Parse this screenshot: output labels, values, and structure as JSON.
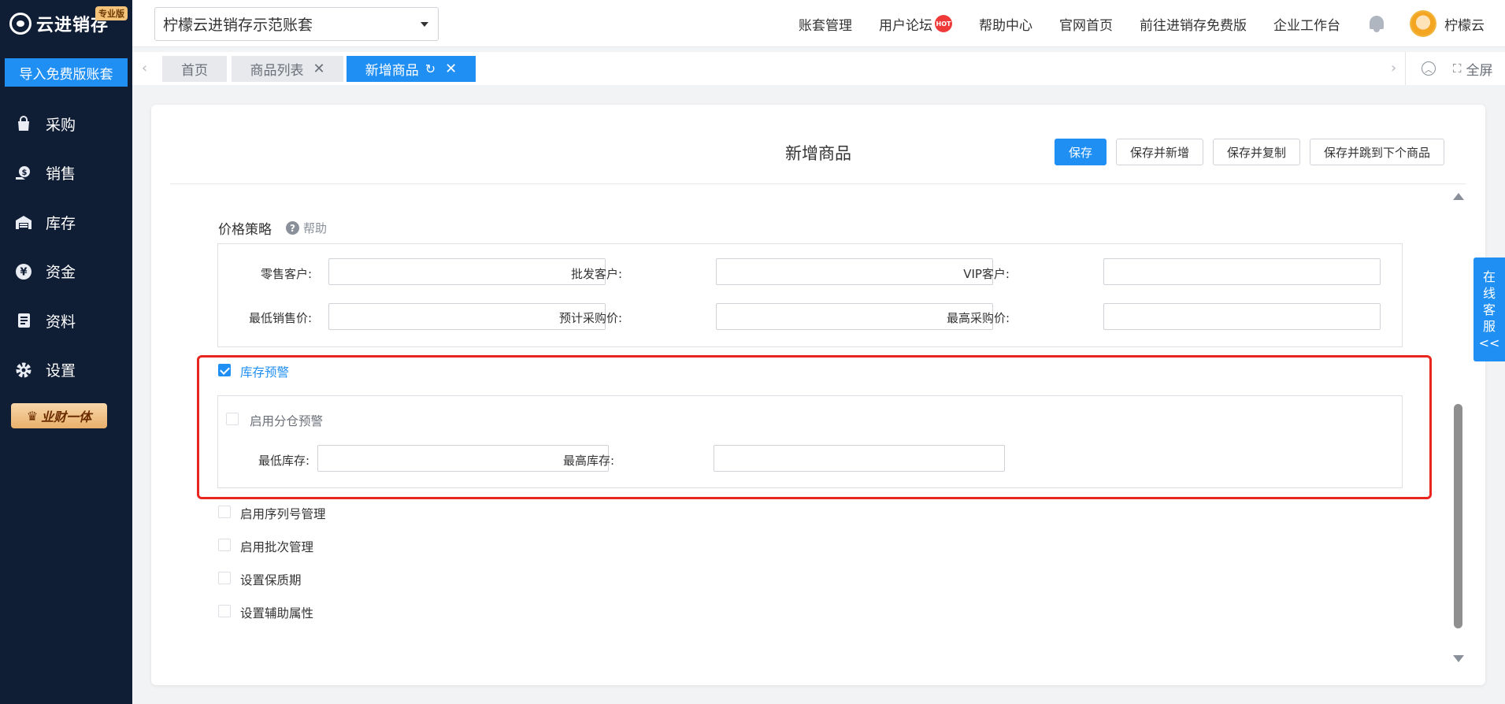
{
  "sidebar": {
    "logo_text": "云进销存",
    "logo_badge": "专业版",
    "import_button": "导入免费版账套",
    "items": [
      {
        "label": "采购",
        "icon": "bag-icon"
      },
      {
        "label": "销售",
        "icon": "coin-hand-icon"
      },
      {
        "label": "库存",
        "icon": "warehouse-icon"
      },
      {
        "label": "资金",
        "icon": "yen-icon"
      },
      {
        "label": "资料",
        "icon": "document-icon"
      },
      {
        "label": "设置",
        "icon": "gear-icon"
      }
    ],
    "promo": "业财一体"
  },
  "topbar": {
    "account_name": "柠檬云进销存示范账套",
    "links": [
      "账套管理",
      "用户论坛",
      "帮助中心",
      "官网首页",
      "前往进销存免费版",
      "企业工作台"
    ],
    "hot_badge": "HOT",
    "user_name": "柠檬云"
  },
  "tabs": {
    "items": [
      {
        "label": "首页"
      },
      {
        "label": "商品列表"
      },
      {
        "label": "新增商品"
      }
    ],
    "fullscreen": "全屏"
  },
  "page": {
    "title": "新增商品",
    "buttons": {
      "save": "保存",
      "save_new": "保存并新增",
      "save_copy": "保存并复制",
      "save_next": "保存并跳到下个商品"
    },
    "price_section": {
      "title": "价格策略",
      "help": "帮助",
      "fields": {
        "retail": {
          "label": "零售客户:",
          "value": ""
        },
        "wholesale": {
          "label": "批发客户:",
          "value": ""
        },
        "vip": {
          "label": "VIP客户:",
          "value": ""
        },
        "min_sale": {
          "label": "最低销售价:",
          "value": ""
        },
        "est_purchase": {
          "label": "预计采购价:",
          "value": ""
        },
        "max_purchase": {
          "label": "最高采购价:",
          "value": ""
        }
      }
    },
    "stock_alert": {
      "label": "库存预警",
      "checked": true,
      "warehouse_alert": "启用分仓预警",
      "min_stock": {
        "label": "最低库存:",
        "value": ""
      },
      "max_stock": {
        "label": "最高库存:",
        "value": ""
      }
    },
    "options": [
      "启用序列号管理",
      "启用批次管理",
      "设置保质期",
      "设置辅助属性"
    ]
  },
  "service": [
    "在",
    "线",
    "客",
    "服",
    "<<"
  ]
}
